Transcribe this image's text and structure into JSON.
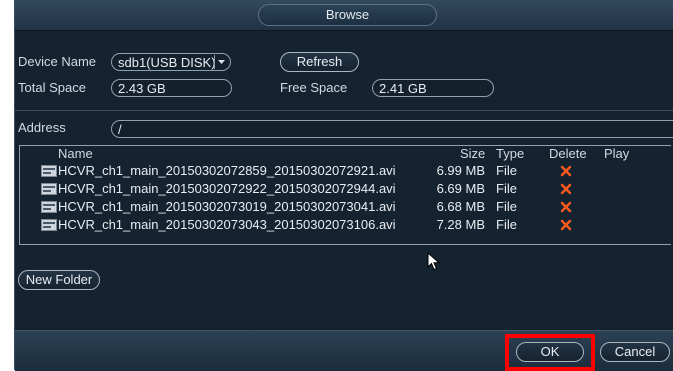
{
  "dialog": {
    "title": "Browse"
  },
  "device": {
    "name_label": "Device Name",
    "name_value": "sdb1(USB DISK)",
    "refresh_label": "Refresh",
    "total_label": "Total Space",
    "total_value": "2.43 GB",
    "free_label": "Free Space",
    "free_value": "2.41 GB"
  },
  "address": {
    "label": "Address",
    "value": "/"
  },
  "file_list": {
    "columns": {
      "name": "Name",
      "size": "Size",
      "type": "Type",
      "delete": "Delete",
      "play": "Play"
    },
    "rows": [
      {
        "name": "HCVR_ch1_main_20150302072859_20150302072921.avi",
        "size": "6.99 MB",
        "type": "File"
      },
      {
        "name": "HCVR_ch1_main_20150302072922_20150302072944.avi",
        "size": "6.69 MB",
        "type": "File"
      },
      {
        "name": "HCVR_ch1_main_20150302073019_20150302073041.avi",
        "size": "6.68 MB",
        "type": "File"
      },
      {
        "name": "HCVR_ch1_main_20150302073043_20150302073106.avi",
        "size": "7.28 MB",
        "type": "File"
      }
    ]
  },
  "actions": {
    "new_folder": "New Folder",
    "ok": "OK",
    "cancel": "Cancel"
  },
  "colors": {
    "background": "#15222f",
    "delete_icon": "#ff5a1e",
    "highlight": "#ff0000"
  },
  "icons": {
    "file": "file-icon",
    "delete": "delete-x-icon",
    "dropdown": "chevron-down-icon",
    "cursor": "mouse-cursor-icon"
  }
}
